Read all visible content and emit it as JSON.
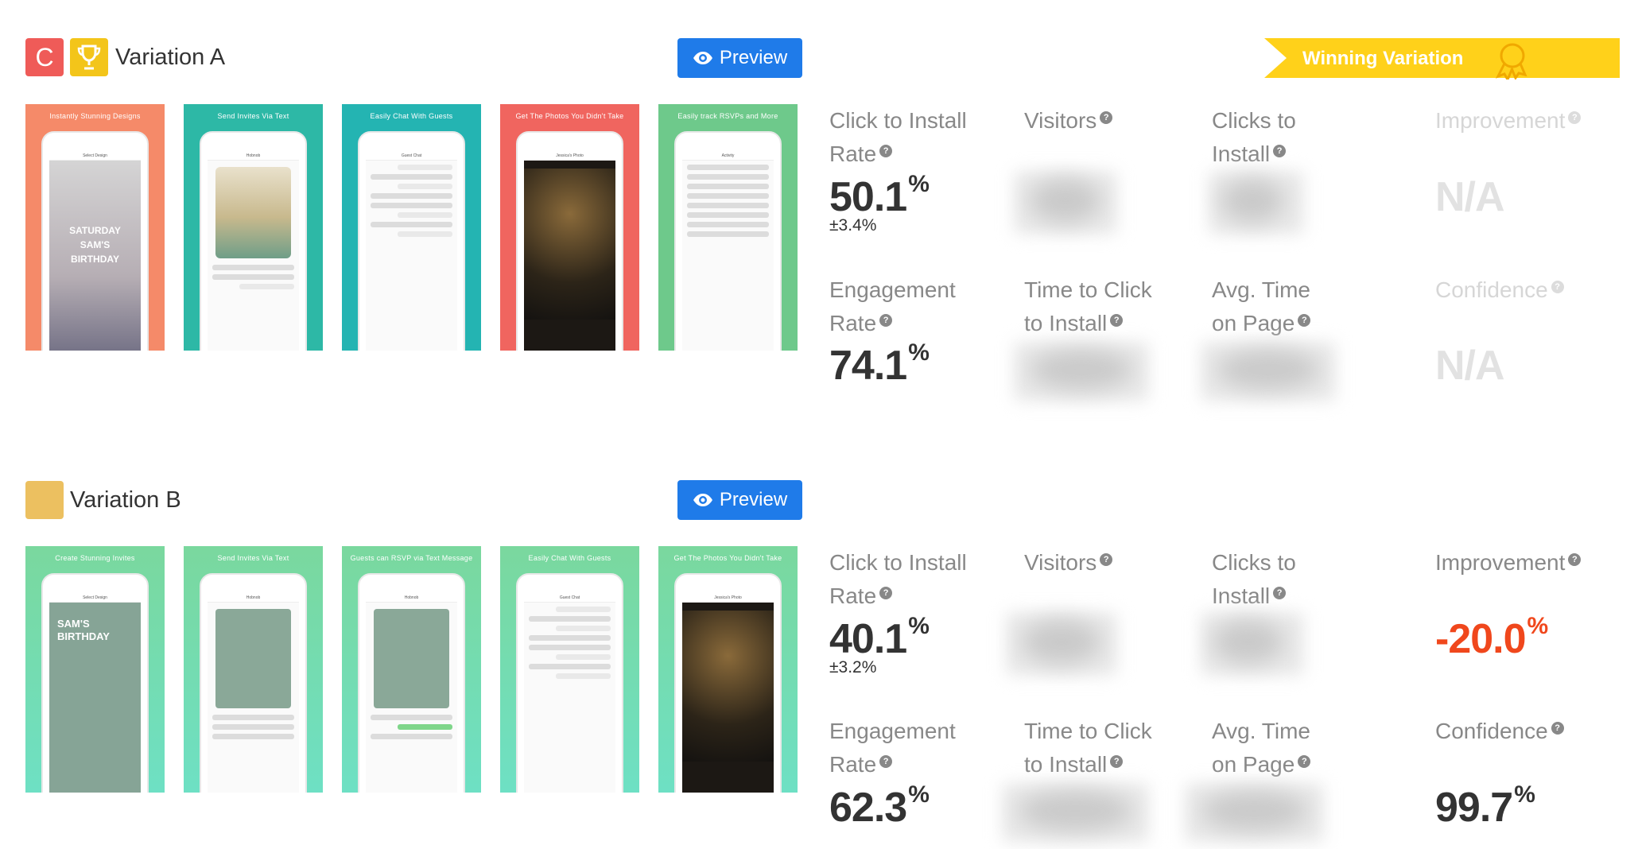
{
  "colors": {
    "accent": "#1f7be9",
    "badge_c": "#ef5b58",
    "badge_trophy": "#f3c51a",
    "badge_b": "#ecc060",
    "winning": "#ffd11a",
    "negative": "#f0471c"
  },
  "variations": [
    {
      "badge_letter": "C",
      "title": "Variation A",
      "preview_label": "Preview",
      "winning_label": "Winning Variation",
      "screenshots": [
        {
          "caption": "Instantly Stunning Designs",
          "bg": "#f58a69"
        },
        {
          "caption": "Send Invites Via Text",
          "bg": "#2db8a6"
        },
        {
          "caption": "Easily Chat With Guests",
          "bg": "#24b4b2"
        },
        {
          "caption": "Get The Photos You Didn't Take",
          "bg": "#f0655f"
        },
        {
          "caption": "Easily track RSVPs and More",
          "bg": "#6ec98b"
        }
      ],
      "metrics": {
        "ctir_label_1": "Click to Install",
        "ctir_label_2": "Rate",
        "ctir_value": "50.1",
        "ctir_ci": "±3.4%",
        "visitors_label": "Visitors",
        "clicks_label_1": "Clicks to",
        "clicks_label_2": "Install",
        "improvement_label": "Improvement",
        "improvement_value": "N/A",
        "engagement_label_1": "Engagement",
        "engagement_label_2": "Rate",
        "engagement_value": "74.1",
        "ttc_label_1": "Time to Click",
        "ttc_label_2": "to Install",
        "avg_label_1": "Avg. Time",
        "avg_label_2": "on Page",
        "confidence_label": "Confidence",
        "confidence_value": "N/A",
        "percent": "%"
      }
    },
    {
      "title": "Variation B",
      "preview_label": "Preview",
      "screenshots": [
        {
          "caption": "Create Stunning Invites",
          "bg": "#6fd9a6"
        },
        {
          "caption": "Send Invites Via Text",
          "bg": "#6fd9a6"
        },
        {
          "caption": "Guests can RSVP via Text Message",
          "bg": "#6fd9a6"
        },
        {
          "caption": "Easily Chat With Guests",
          "bg": "#6fd9a6"
        },
        {
          "caption": "Get The Photos You Didn't Take",
          "bg": "#6fd9a6"
        }
      ],
      "metrics": {
        "ctir_label_1": "Click to Install",
        "ctir_label_2": "Rate",
        "ctir_value": "40.1",
        "ctir_ci": "±3.2%",
        "visitors_label": "Visitors",
        "clicks_label_1": "Clicks to",
        "clicks_label_2": "Install",
        "improvement_label": "Improvement",
        "improvement_value": "-20.0",
        "engagement_label_1": "Engagement",
        "engagement_label_2": "Rate",
        "engagement_value": "62.3",
        "ttc_label_1": "Time to Click",
        "ttc_label_2": "to Install",
        "avg_label_1": "Avg. Time",
        "avg_label_2": "on Page",
        "confidence_label": "Confidence",
        "confidence_value": "99.7",
        "percent": "%"
      }
    }
  ]
}
